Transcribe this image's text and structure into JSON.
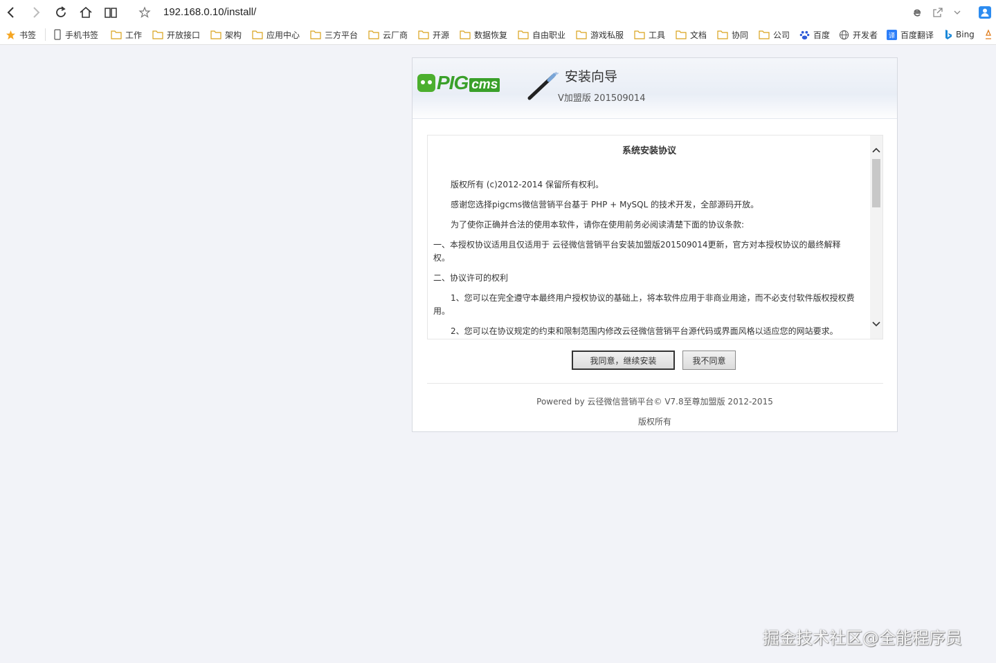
{
  "browser": {
    "url": "192.168.0.10/install/",
    "bookmarks": [
      {
        "label": "书签",
        "icon": "star-icon"
      },
      {
        "label": "手机书签",
        "icon": "mobile-icon"
      },
      {
        "label": "工作",
        "icon": "folder-icon"
      },
      {
        "label": "开放接口",
        "icon": "folder-icon"
      },
      {
        "label": "架构",
        "icon": "folder-icon"
      },
      {
        "label": "应用中心",
        "icon": "folder-icon"
      },
      {
        "label": "三方平台",
        "icon": "folder-icon"
      },
      {
        "label": "云厂商",
        "icon": "folder-icon"
      },
      {
        "label": "开源",
        "icon": "folder-icon"
      },
      {
        "label": "数据恢复",
        "icon": "folder-icon"
      },
      {
        "label": "自由职业",
        "icon": "folder-icon"
      },
      {
        "label": "游戏私服",
        "icon": "folder-icon"
      },
      {
        "label": "工具",
        "icon": "folder-icon"
      },
      {
        "label": "文档",
        "icon": "folder-icon"
      },
      {
        "label": "协同",
        "icon": "folder-icon"
      },
      {
        "label": "公司",
        "icon": "folder-icon"
      },
      {
        "label": "百度",
        "icon": "baidu-paw-icon"
      },
      {
        "label": "开发者",
        "icon": "globe-icon"
      },
      {
        "label": "百度翻译",
        "icon": "translate-icon"
      },
      {
        "label": "Bing",
        "icon": "bing-icon"
      }
    ]
  },
  "installer": {
    "logo_text": "PIG",
    "logo_suffix": "cms",
    "title": "安装向导",
    "version": "V加盟版 201509014",
    "agreement_title": "系统安装协议",
    "agreement_paragraphs": [
      "版权所有 (c)2012-2014 保留所有权利。",
      "感谢您选择pigcms微信营销平台基于 PHP + MySQL  的技术开发，全部源码开放。",
      "为了使你正确并合法的使用本软件，请你在使用前务必阅读清楚下面的协议条款:",
      "一、本授权协议适用且仅适用于 云径微信营销平台安装加盟版201509014更新，官方对本授权协议的最终解释权。",
      "二、协议许可的权利",
      "1、您可以在完全遵守本最终用户授权协议的基础上，将本软件应用于非商业用途，而不必支付软件版权授权费用。",
      "2、您可以在协议规定的约束和限制范围内修改云径微信营销平台源代码或界面风格以适应您的网站要求。"
    ],
    "agree_button": "我同意，继续安装",
    "disagree_button": "我不同意",
    "powered_by": "Powered by 云径微信营销平台© V7.8至尊加盟版 2012-2015",
    "rights": "版权所有"
  },
  "watermark": "掘金技术社区@全能程序员"
}
